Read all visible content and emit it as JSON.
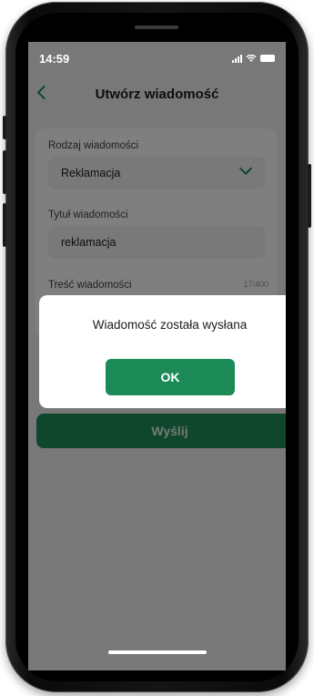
{
  "status_bar": {
    "time": "14:59"
  },
  "header": {
    "title": "Utwórz wiadomość"
  },
  "form": {
    "type_label": "Rodzaj wiadomości",
    "type_value": "Reklamacja",
    "title_label": "Tytuł wiadomości",
    "title_value": "reklamacja",
    "content_label": "Treść wiadomości",
    "content_counter": "17/400"
  },
  "send_button": {
    "label": "Wyślij"
  },
  "dialog": {
    "message": "Wiadomość została wysłana",
    "ok_label": "OK"
  },
  "colors": {
    "accent": "#1b8a56",
    "overlay": "rgba(0,0,0,0.5)"
  }
}
